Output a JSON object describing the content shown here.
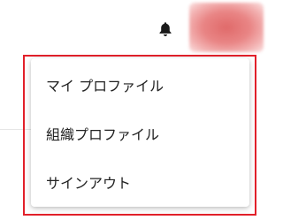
{
  "header": {
    "notification_icon": "bell-icon",
    "avatar_icon": "user-avatar"
  },
  "user_menu": {
    "items": [
      {
        "label": "マイ プロファイル"
      },
      {
        "label": "組織プロファイル"
      },
      {
        "label": "サインアウト"
      }
    ]
  },
  "colors": {
    "highlight_border": "#e2202a",
    "avatar": "#e06a6a",
    "text": "#222222"
  }
}
